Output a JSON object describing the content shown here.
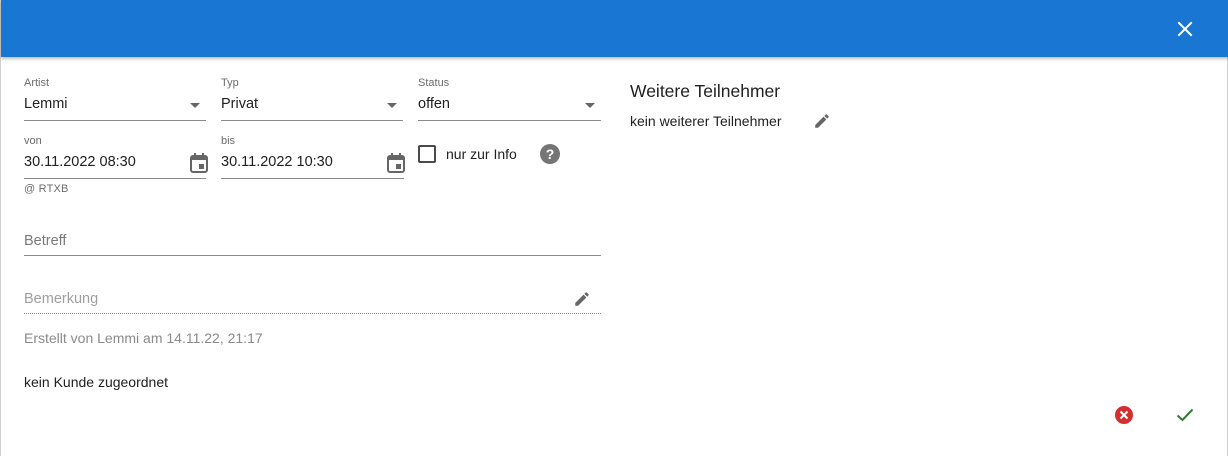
{
  "colors": {
    "appbar": "#1976d2",
    "cancel": "#d32f2f",
    "confirm": "#2e7d32"
  },
  "header": {
    "close_icon": "close-icon"
  },
  "form": {
    "artist": {
      "label": "Artist",
      "value": "Lemmi"
    },
    "typ": {
      "label": "Typ",
      "value": "Privat"
    },
    "status": {
      "label": "Status",
      "value": "offen"
    },
    "von": {
      "label": "von",
      "value": "30.11.2022 08:30",
      "hint": "@ RTXB"
    },
    "bis": {
      "label": "bis",
      "value": "30.11.2022 10:30"
    },
    "info_checkbox": {
      "label": "nur zur Info",
      "checked": false
    },
    "betreff": {
      "placeholder": "Betreff"
    },
    "bemerkung": {
      "placeholder": "Bemerkung"
    },
    "created_text": "Erstellt von Lemmi am 14.11.22, 21:17",
    "customer_text": "kein Kunde zugeordnet"
  },
  "participants": {
    "title": "Weitere Teilnehmer",
    "text": "kein weiterer Teilnehmer"
  }
}
